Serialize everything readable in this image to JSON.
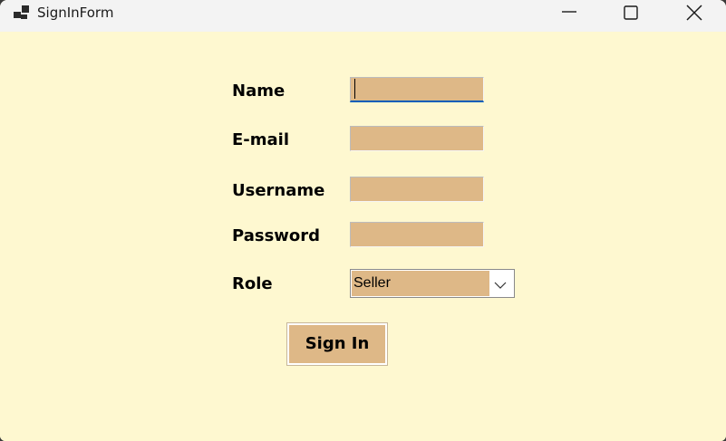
{
  "window": {
    "title": "SignInForm",
    "client_bg": "#fef8d0",
    "field_bg": "#deb887",
    "focus_accent": "#005fb8"
  },
  "titlebar_icons": [
    "app-icon",
    "minimize-icon",
    "maximize-icon",
    "close-icon"
  ],
  "form": {
    "name_label": "Name",
    "name_value": "",
    "email_label": "E-mail",
    "email_value": "",
    "username_label": "Username",
    "username_value": "",
    "password_label": "Password",
    "password_value": "",
    "role_label": "Role",
    "role_selected": "Seller",
    "submit_label": "Sign In"
  }
}
